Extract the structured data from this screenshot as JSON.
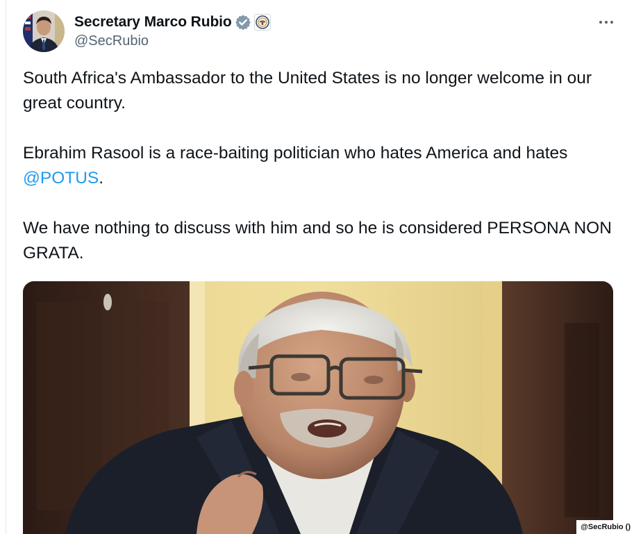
{
  "post": {
    "author": {
      "display_name": "Secretary Marco Rubio",
      "handle": "@SecRubio",
      "avatar_icon": "profile-photo",
      "verified_icon": "verified-badge-icon",
      "affiliation_icon": "state-department-seal-icon"
    },
    "more_icon": "more-options-icon",
    "paragraphs": [
      "South Africa's Ambassador to the United States is no longer welcome in our great country.",
      "Ebrahim Rasool is a race-baiting politician who hates America and hates ",
      "We have nothing to discuss with him and so he is considered PERSONA NON GRATA."
    ],
    "mention": "@POTUS",
    "mention_suffix": ".",
    "media": {
      "kind": "video-still"
    }
  },
  "credit": "@SecRubio ()",
  "colors": {
    "text": "#0f1419",
    "secondary": "#536471",
    "link": "#1d9bf0",
    "verified": "#829aab"
  }
}
